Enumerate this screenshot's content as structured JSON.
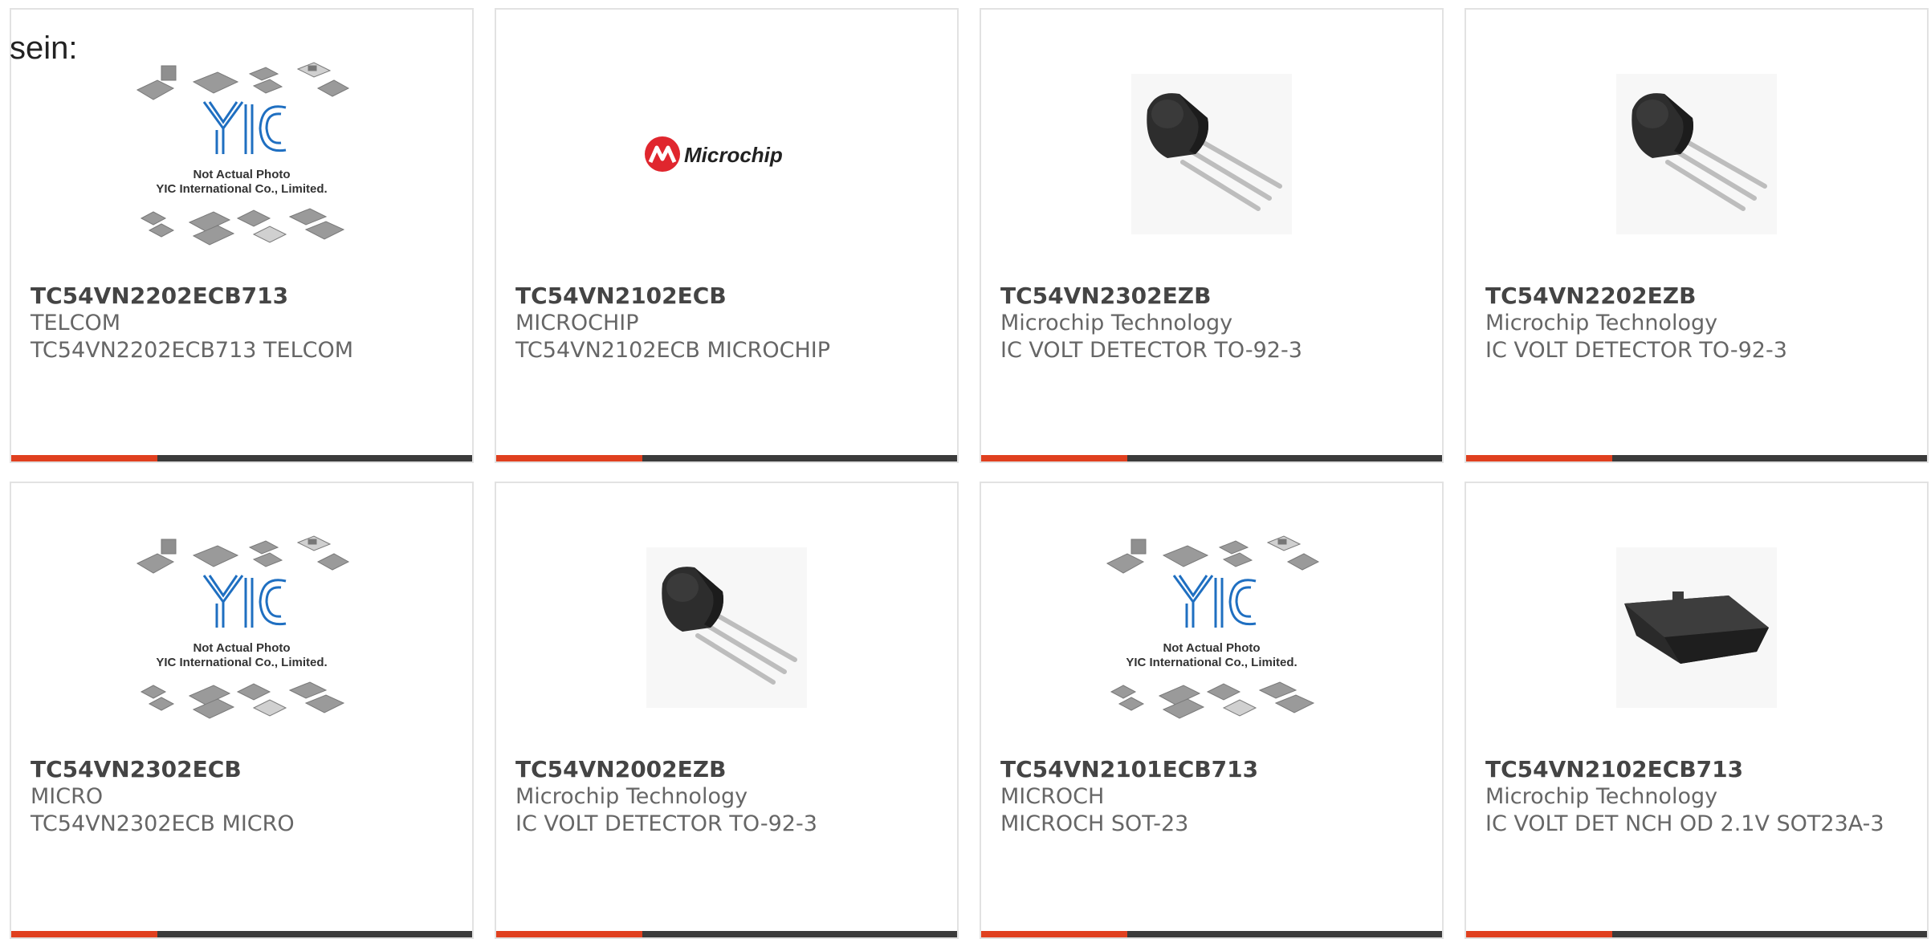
{
  "intro_text": "sein:",
  "placeholder": {
    "line1": "Not Actual Photo",
    "line2": "YIC International Co., Limited."
  },
  "logo_text": "Microchip",
  "colors": {
    "accent": "#e0401f",
    "bar": "#3b3b3b",
    "logo_red": "#e0262e",
    "yic_blue": "#1f6fc1"
  },
  "products": [
    {
      "part": "TC54VN2202ECB713",
      "maker": "TELCOM",
      "desc": "TC54VN2202ECB713 TELCOM",
      "image": "yic-placeholder"
    },
    {
      "part": "TC54VN2102ECB",
      "maker": "MICROCHIP",
      "desc": "TC54VN2102ECB MICROCHIP",
      "image": "microchip-logo"
    },
    {
      "part": "TC54VN2302EZB",
      "maker": "Microchip Technology",
      "desc": "IC VOLT DETECTOR TO-92-3",
      "image": "to92-transistor"
    },
    {
      "part": "TC54VN2202EZB",
      "maker": "Microchip Technology",
      "desc": "IC VOLT DETECTOR TO-92-3",
      "image": "to92-transistor"
    },
    {
      "part": "TC54VN2302ECB",
      "maker": "MICRO",
      "desc": "TC54VN2302ECB MICRO",
      "image": "yic-placeholder"
    },
    {
      "part": "TC54VN2002EZB",
      "maker": "Microchip Technology",
      "desc": "IC VOLT DETECTOR TO-92-3",
      "image": "to92-transistor"
    },
    {
      "part": "TC54VN2101ECB713",
      "maker": "MICROCH",
      "desc": "MICROCH SOT-23",
      "image": "yic-placeholder"
    },
    {
      "part": "TC54VN2102ECB713",
      "maker": "Microchip Technology",
      "desc": "IC VOLT DET NCH OD 2.1V SOT23A-3",
      "image": "sot23-package"
    }
  ]
}
